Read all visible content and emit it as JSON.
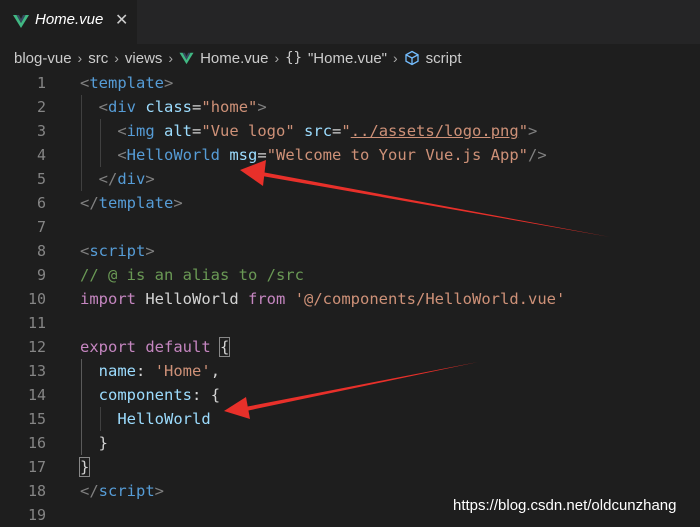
{
  "tab": {
    "label": "Home.vue",
    "close": "✕",
    "icon": "vue-icon"
  },
  "breadcrumb": {
    "items": [
      "blog-vue",
      "src",
      "views",
      "Home.vue",
      "\"Home.vue\"",
      "script"
    ],
    "separator": "›"
  },
  "lines": [
    {
      "num": "1"
    },
    {
      "num": "2"
    },
    {
      "num": "3"
    },
    {
      "num": "4"
    },
    {
      "num": "5"
    },
    {
      "num": "6"
    },
    {
      "num": "7"
    },
    {
      "num": "8"
    },
    {
      "num": "9"
    },
    {
      "num": "10"
    },
    {
      "num": "11"
    },
    {
      "num": "12"
    },
    {
      "num": "13"
    },
    {
      "num": "14"
    },
    {
      "num": "15"
    },
    {
      "num": "16"
    },
    {
      "num": "17"
    },
    {
      "num": "18"
    },
    {
      "num": "19"
    }
  ],
  "code": {
    "l1": {
      "open": "<",
      "tag": "template",
      "close": ">"
    },
    "l2": {
      "open": "<",
      "tag": "div",
      "attr": "class",
      "eq": "=",
      "val": "\"home\"",
      "close": ">"
    },
    "l3": {
      "open": "<",
      "tag": "img",
      "attr1": "alt",
      "eq1": "=",
      "val1": "\"Vue logo\"",
      "attr2": "src",
      "eq2": "=",
      "q1": "\"",
      "path": "../assets/logo.png",
      "q2": "\"",
      "close": ">"
    },
    "l4": {
      "open": "<",
      "tag": "HelloWorld",
      "attr": "msg",
      "eq": "=",
      "val": "\"Welcome to Your Vue.js App\"",
      "close": "/>"
    },
    "l5": {
      "open": "</",
      "tag": "div",
      "close": ">"
    },
    "l6": {
      "open": "</",
      "tag": "template",
      "close": ">"
    },
    "l8": {
      "open": "<",
      "tag": "script",
      "close": ">"
    },
    "l9": {
      "comment": "// @ is an alias to /src"
    },
    "l10": {
      "kw1": "import",
      "name": "HelloWorld",
      "kw2": "from",
      "str": "'@/components/HelloWorld.vue'"
    },
    "l12": {
      "kw1": "export",
      "kw2": "default",
      "brace": "{"
    },
    "l13": {
      "key": "name",
      "colon": ":",
      "str": "'Home'",
      "comma": ","
    },
    "l14": {
      "key": "components",
      "colon": ":",
      "brace": "{"
    },
    "l15": {
      "name": "HelloWorld"
    },
    "l16": {
      "brace": "}"
    },
    "l17": {
      "brace": "}"
    },
    "l18": {
      "open": "</",
      "tag": "script",
      "close": ">"
    }
  },
  "watermark": "https://blog.csdn.net/oldcunzhang",
  "colors": {
    "background": "#1e1e1e",
    "tag": "#569cd6",
    "attribute": "#9cdcfe",
    "string": "#ce9178",
    "comment": "#6a9955",
    "keyword": "#c586c0",
    "vue_green": "#41b883",
    "arrow": "#e8302a"
  }
}
